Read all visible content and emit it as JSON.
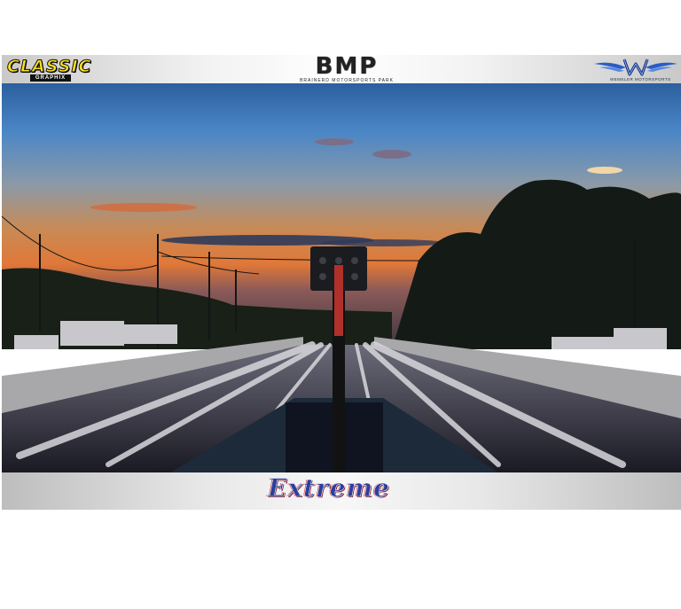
{
  "header": {
    "left_logo": {
      "name": "CLASSIC",
      "subtitle": "GRAPHIX"
    },
    "center_logo": {
      "name": "BMP",
      "subtitle": "BRAINERD MOTORSPORTS PARK"
    },
    "right_logo": {
      "name": "WM",
      "subtitle": "WEMELER MOTORSPORTS"
    }
  },
  "footer": {
    "logo": "Extreme"
  },
  "colors": {
    "accent_yellow": "#ffe21a",
    "extreme_blue": "#2c3e9e",
    "wm_blue": "#2a5cc7"
  }
}
